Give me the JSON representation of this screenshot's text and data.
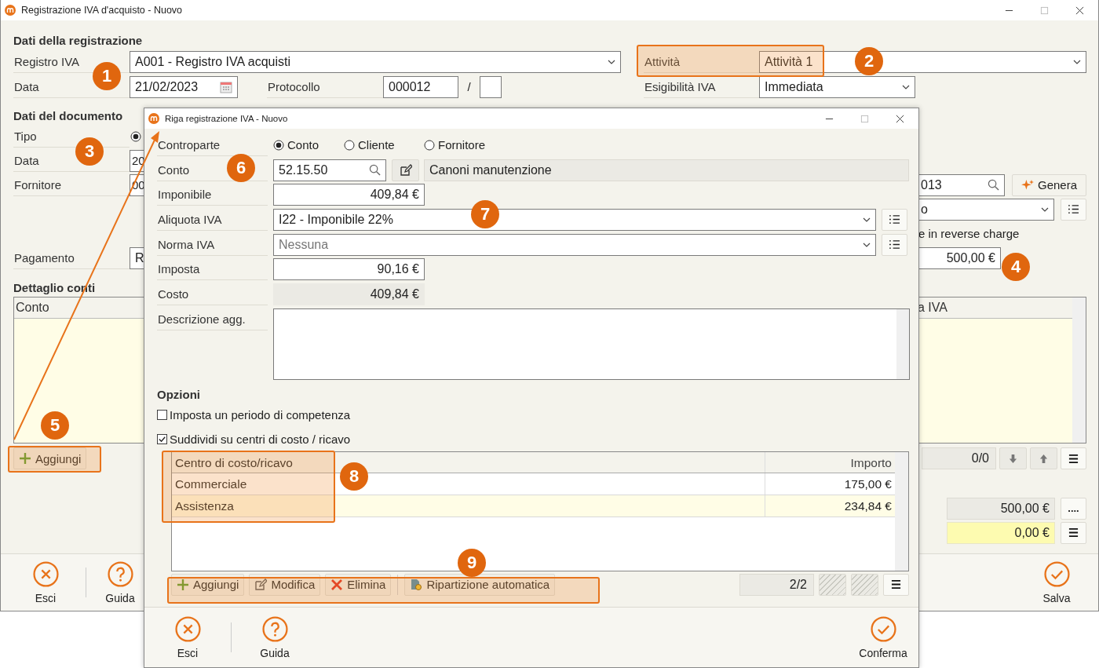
{
  "window": {
    "title": "Registrazione IVA d'acquisto - Nuovo"
  },
  "registrazione": {
    "heading": "Dati della registrazione",
    "registro_label": "Registro IVA",
    "registro": "A001 - Registro IVA acquisti",
    "data_label": "Data",
    "data": "21/02/2023",
    "protocollo_label": "Protocollo",
    "protocollo": "000012",
    "separator": "/",
    "attivita_label": "Attività",
    "attivita": "Attività 1",
    "esigibilita_label": "Esigibilità IVA",
    "esigibilita": "Immediata"
  },
  "documento": {
    "heading": "Dati del documento",
    "tipo_label": "Tipo",
    "tipo_radio": {
      "selected": true
    },
    "data_label": "Data",
    "data": "20",
    "fornitore_label": "Fornitore",
    "fornitore": "00",
    "numero": "013",
    "genera": "Genera",
    "field_2": "o",
    "reverse_charge": "e in reverse charge",
    "pagamento_label": "Pagamento",
    "pagamento": "R",
    "totale": "500,00 €"
  },
  "dettaglio": {
    "heading": "Dettaglio conti",
    "columns": [
      "Conto",
      "a IVA"
    ],
    "add": "Aggiungi",
    "counter": "0/0",
    "total": "500,00 €",
    "more": "....",
    "difference": "0,00 €"
  },
  "footer": [
    {
      "label": "Esci",
      "kind": "exit"
    },
    {
      "label": "Guida",
      "kind": "help"
    },
    {
      "label": "Salva",
      "kind": "confirm"
    }
  ],
  "dialog": {
    "title": "Riga registrazione IVA - Nuovo",
    "controparte_label": "Controparte",
    "controparte": [
      {
        "label": "Conto",
        "selected": true
      },
      {
        "label": "Cliente",
        "selected": false
      },
      {
        "label": "Fornitore",
        "selected": false
      }
    ],
    "fields": [
      {
        "label": "Conto",
        "kind": "account",
        "value": "52.15.50",
        "description": "Canoni manutenzione"
      },
      {
        "label": "Imponibile",
        "kind": "amount",
        "value": "409,84 €"
      },
      {
        "label": "Aliquota IVA",
        "kind": "select",
        "value": "I22 - Imponibile 22%"
      },
      {
        "label": "Norma IVA",
        "kind": "select",
        "placeholder": "Nessuna"
      },
      {
        "label": "Imposta",
        "kind": "amount",
        "value": "90,16 €"
      },
      {
        "label": "Costo",
        "kind": "readonly",
        "value": "409,84 €"
      },
      {
        "label": "Descrizione agg.",
        "kind": "textarea"
      }
    ],
    "options_heading": "Opzioni",
    "options": [
      {
        "label": "Imposta un periodo di competenza",
        "checked": false
      },
      {
        "label": "Suddividi su centri di costo / ricavo",
        "checked": true
      }
    ],
    "table": {
      "columns": [
        "Centro di costo/ricavo",
        "Importo"
      ],
      "rows": [
        {
          "centro": "Commerciale",
          "importo": "175,00 €",
          "selected": false
        },
        {
          "centro": "Assistenza",
          "importo": "234,84 €",
          "selected": true
        }
      ]
    },
    "toolbar": [
      {
        "label": "Aggiungi",
        "kind": "add"
      },
      {
        "label": "Modifica",
        "kind": "edit"
      },
      {
        "label": "Elimina",
        "kind": "delete"
      },
      {
        "label": "Ripartizione automatica",
        "kind": "auto"
      }
    ],
    "counter": "2/2",
    "footer": [
      {
        "label": "Esci",
        "kind": "exit"
      },
      {
        "label": "Guida",
        "kind": "help"
      },
      {
        "label": "Conferma",
        "kind": "confirm"
      }
    ]
  },
  "annotations": [
    {
      "label": "1"
    },
    {
      "label": "2"
    },
    {
      "label": "3"
    },
    {
      "label": "4"
    },
    {
      "label": "5"
    },
    {
      "label": "6"
    },
    {
      "label": "7"
    },
    {
      "label": "8"
    },
    {
      "label": "9"
    }
  ]
}
